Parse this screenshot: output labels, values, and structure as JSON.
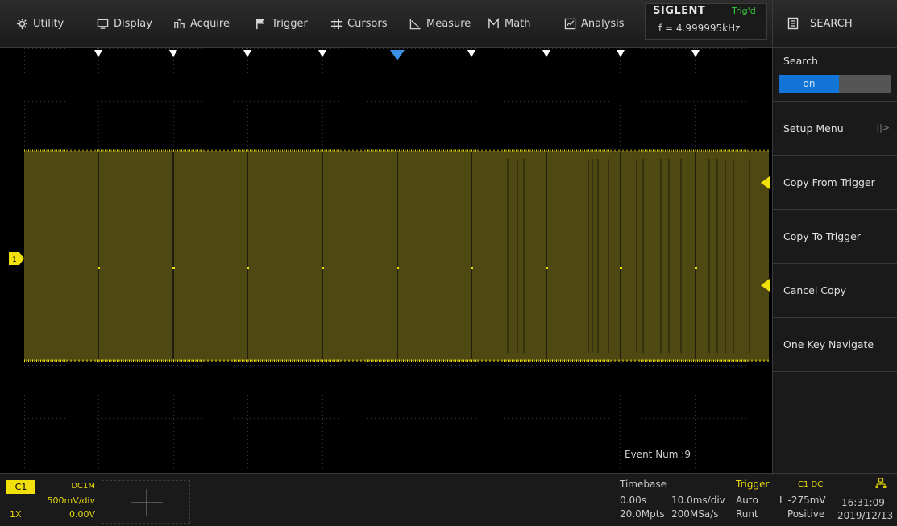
{
  "menu": {
    "items": [
      {
        "label": "Utility",
        "icon": "gear-icon",
        "x": 0
      },
      {
        "label": "Display",
        "icon": "monitor-icon"
      },
      {
        "label": "Acquire",
        "icon": "acquire-icon"
      },
      {
        "label": "Trigger",
        "icon": "flag-icon"
      },
      {
        "label": "Cursors",
        "icon": "cursors-icon"
      },
      {
        "label": "Measure",
        "icon": "measure-icon"
      },
      {
        "label": "Math",
        "icon": "math-icon"
      },
      {
        "label": "Analysis",
        "icon": "analysis-icon"
      }
    ],
    "utility": "Utility",
    "display": "Display",
    "acquire": "Acquire",
    "trigger": "Trigger",
    "cursors": "Cursors",
    "measure": "Measure",
    "math": "Math",
    "analysis": "Analysis"
  },
  "brand": {
    "name": "SIGLENT",
    "status": "Trig'd",
    "frequency": "f = 4.999995kHz"
  },
  "panel": {
    "title": "SEARCH",
    "search_label": "Search",
    "search_state": "on",
    "setup_menu": "Setup Menu",
    "copy_from_trigger": "Copy From Trigger",
    "copy_to_trigger": "Copy To Trigger",
    "cancel_copy": "Cancel Copy",
    "one_key_navigate": "One Key Navigate"
  },
  "screen": {
    "event_num": "Event Num :9",
    "ch1_marker": "1",
    "trace_color": "#f2e00d",
    "fill_color": "#4e4812"
  },
  "channel1": {
    "name": "C1",
    "coupling": "DC1M",
    "scale": "500mV/div",
    "probe": "1X",
    "offset": "0.00V"
  },
  "timebase": {
    "title": "Timebase",
    "delay": "0.00s",
    "scale": "10.0ms/div",
    "memory": "20.0Mpts",
    "sample_rate": "200MSa/s"
  },
  "trigger": {
    "title": "Trigger",
    "source": "C1 DC",
    "mode": "Auto",
    "level": "L -275mV",
    "type": "Runt",
    "polarity": "Positive"
  },
  "clock": {
    "time": "16:31:09",
    "date": "2019/12/13"
  },
  "colors": {
    "accent_yellow": "#f2e00d",
    "search_on_blue": "#1274d4",
    "status_green": "#3bd13b"
  }
}
